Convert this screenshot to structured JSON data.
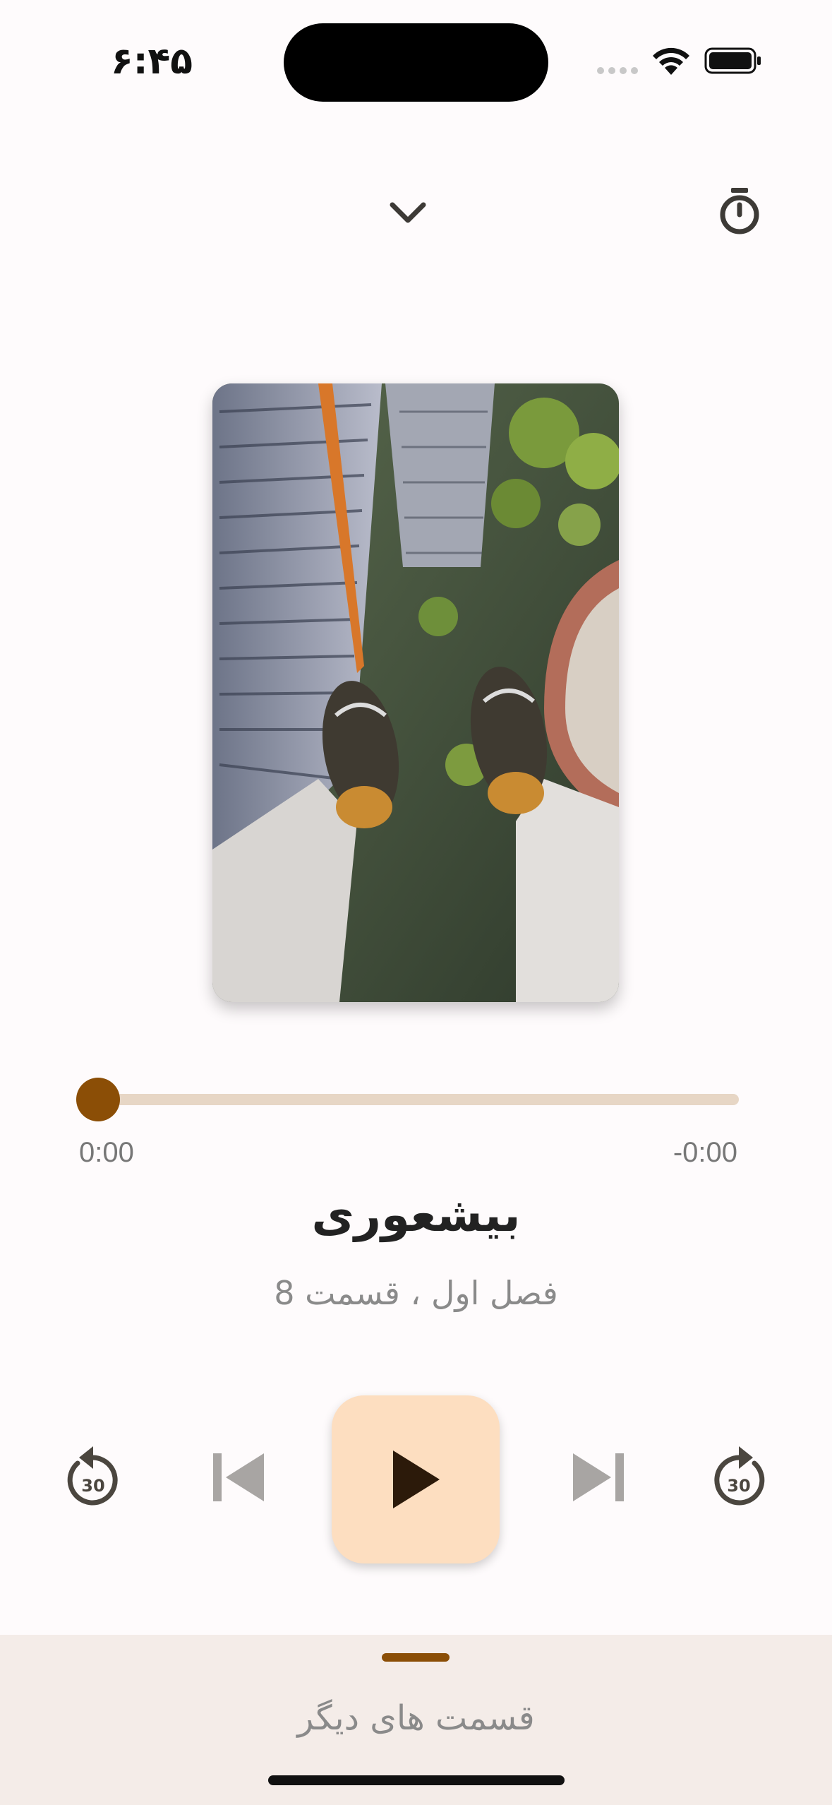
{
  "status_bar": {
    "time": "۶:۴۵"
  },
  "icons": {
    "collapse": "chevron-down-icon",
    "timer": "stopwatch-icon",
    "rewind": "replay-30-icon",
    "previous": "skip-previous-icon",
    "play": "play-icon",
    "next": "skip-next-icon",
    "forward": "forward-30-icon"
  },
  "player": {
    "progress": 0,
    "elapsed": "0:00",
    "remaining": "-0:00",
    "title": "بیشعوری",
    "subtitle": "فصل اول ، قسمت 8",
    "rewind_seconds": "30",
    "forward_seconds": "30"
  },
  "bottom_sheet": {
    "label": "قسمت های دیگر"
  },
  "colors": {
    "accent": "#8b4e06",
    "track": "#e7d6c5",
    "play_bg": "#fddec0",
    "sheet_bg": "#f4ece8"
  }
}
